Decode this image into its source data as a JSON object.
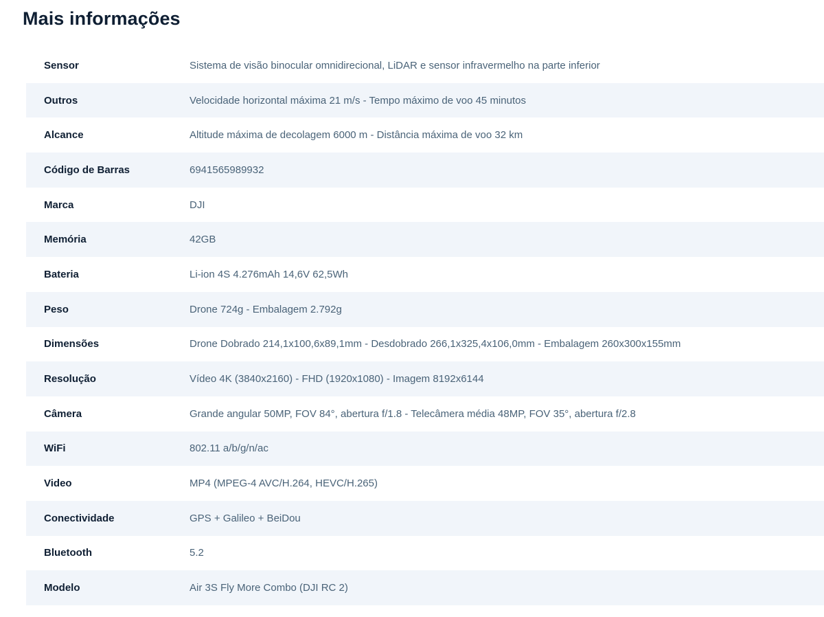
{
  "section": {
    "title": "Mais informações"
  },
  "specs": [
    {
      "label": "Sensor",
      "value": "Sistema de visão binocular omnidirecional, LiDAR e sensor infravermelho na parte inferior"
    },
    {
      "label": "Outros",
      "value": "Velocidade horizontal máxima 21 m/s - Tempo máximo de voo 45 minutos"
    },
    {
      "label": "Alcance",
      "value": "Altitude máxima de decolagem 6000 m - Distância máxima de voo 32 km"
    },
    {
      "label": "Código de Barras",
      "value": "6941565989932"
    },
    {
      "label": "Marca",
      "value": "DJI"
    },
    {
      "label": "Memória",
      "value": "42GB"
    },
    {
      "label": "Bateria",
      "value": "Li-ion 4S 4.276mAh 14,6V 62,5Wh"
    },
    {
      "label": "Peso",
      "value": "Drone 724g - Embalagem 2.792g"
    },
    {
      "label": "Dimensões",
      "value": "Drone Dobrado 214,1x100,6x89,1mm - Desdobrado 266,1x325,4x106,0mm - Embalagem 260x300x155mm"
    },
    {
      "label": "Resolução",
      "value": "Vídeo 4K (3840x2160) - FHD (1920x1080) - Imagem 8192x6144"
    },
    {
      "label": "Câmera",
      "value": "Grande angular 50MP, FOV 84°, abertura f/1.8 - Telecâmera média 48MP, FOV 35°, abertura f/2.8"
    },
    {
      "label": "WiFi",
      "value": "802.11 a/b/g/n/ac"
    },
    {
      "label": "Video",
      "value": "MP4 (MPEG-4 AVC/H.264, HEVC/H.265)"
    },
    {
      "label": "Conectividade",
      "value": "GPS + Galileo + BeiDou"
    },
    {
      "label": "Bluetooth",
      "value": "5.2"
    },
    {
      "label": "Modelo",
      "value": "Air 3S Fly More Combo (DJI RC 2)"
    }
  ]
}
